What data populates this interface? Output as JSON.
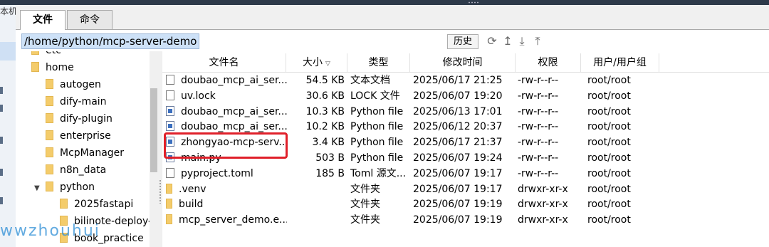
{
  "tabs": [
    {
      "label": "文件"
    },
    {
      "label": "命令"
    }
  ],
  "left_edge_title": "本机",
  "path": "/home/python/mcp-server-demo",
  "toolbar": {
    "history_label": "历史",
    "icons": [
      "refresh-icon",
      "up-icon",
      "download-icon",
      "upload-icon"
    ]
  },
  "tree": {
    "items": [
      {
        "label": "etc",
        "indent": 0,
        "expander": ""
      },
      {
        "label": "home",
        "indent": 0,
        "expander": ""
      },
      {
        "label": "autogen",
        "indent": 1,
        "expander": ""
      },
      {
        "label": "dify-main",
        "indent": 1,
        "expander": ""
      },
      {
        "label": "dify-plugin",
        "indent": 1,
        "expander": ""
      },
      {
        "label": "enterprise",
        "indent": 1,
        "expander": ""
      },
      {
        "label": "McpManager",
        "indent": 1,
        "expander": ""
      },
      {
        "label": "n8n_data",
        "indent": 1,
        "expander": ""
      },
      {
        "label": "python",
        "indent": 1,
        "expander": "▼"
      },
      {
        "label": "2025fastapi",
        "indent": 2,
        "expander": ""
      },
      {
        "label": "bilinote-deploy-ma",
        "indent": 2,
        "expander": ""
      },
      {
        "label": "book_practice",
        "indent": 2,
        "expander": ""
      }
    ]
  },
  "columns": {
    "name": "文件名",
    "size": "大小",
    "type": "类型",
    "mtime": "修改时间",
    "perm": "权限",
    "owner": "用户/用户组"
  },
  "files": [
    {
      "name": "doubao_mcp_ai_ser...",
      "size": "54.5 KB",
      "type": "文本文档",
      "mtime": "2025/06/17 21:25",
      "perm": "-rw-r--r--",
      "owner": "root/root",
      "icon": "doc"
    },
    {
      "name": "uv.lock",
      "size": "30.6 KB",
      "type": "LOCK 文件",
      "mtime": "2025/06/07 19:20",
      "perm": "-rw-r--r--",
      "owner": "root/root",
      "icon": "doc"
    },
    {
      "name": "doubao_mcp_ai_ser...",
      "size": "10.3 KB",
      "type": "Python file",
      "mtime": "2025/06/13 17:01",
      "perm": "-rw-r--r--",
      "owner": "root/root",
      "icon": "py"
    },
    {
      "name": "doubao_mcp_ai_ser...",
      "size": "10.2 KB",
      "type": "Python file",
      "mtime": "2025/06/12 20:37",
      "perm": "-rw-r--r--",
      "owner": "root/root",
      "icon": "py"
    },
    {
      "name": "zhongyao-mcp-serv...",
      "size": "3.4 KB",
      "type": "Python file",
      "mtime": "2025/06/17 21:37",
      "perm": "-rw-r--r--",
      "owner": "root/root",
      "icon": "py"
    },
    {
      "name": "main.py",
      "size": "503 B",
      "type": "Python file",
      "mtime": "2025/06/07 19:24",
      "perm": "-rw-r--r--",
      "owner": "root/root",
      "icon": "py"
    },
    {
      "name": "pyproject.toml",
      "size": "185 B",
      "type": "Toml 源文...",
      "mtime": "2025/06/07 19:17",
      "perm": "-rw-r--r--",
      "owner": "root/root",
      "icon": "doc"
    },
    {
      "name": ".venv",
      "size": "",
      "type": "文件夹",
      "mtime": "2025/06/07 19:17",
      "perm": "drwxr-xr-x",
      "owner": "root/root",
      "icon": "folder"
    },
    {
      "name": "build",
      "size": "",
      "type": "文件夹",
      "mtime": "2025/06/07 19:19",
      "perm": "drwxr-xr-x",
      "owner": "root/root",
      "icon": "folder"
    },
    {
      "name": "mcp_server_demo.e...",
      "size": "",
      "type": "文件夹",
      "mtime": "2025/06/07 19:19",
      "perm": "drwxr-xr-x",
      "owner": "root/root",
      "icon": "folder"
    }
  ],
  "watermark": "wwzhouhui",
  "colors": {
    "path_highlight": "#cde1f7",
    "annotation_box": "#e0202a",
    "folder": "#f4cc6b",
    "watermark": "#2f8fd6"
  }
}
